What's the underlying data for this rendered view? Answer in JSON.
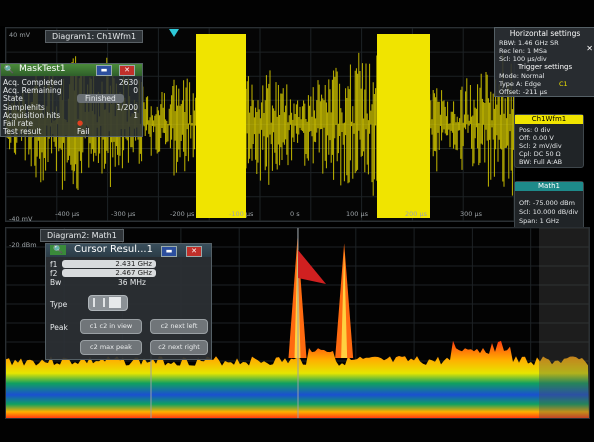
{
  "colors": {
    "waveform": "#f0e400",
    "accent_cyan": "#2ec8d8",
    "panel": "#2c3135",
    "spectrum_hot": "#ff3b10",
    "spectrum_warm": "#ffb000",
    "spectrum_cool": "#10a060"
  },
  "diagram1": {
    "tab": "Diagram1: Ch1Wfm1",
    "y_labels": [
      "40 mV",
      "",
      "",
      "",
      "",
      "",
      "",
      "",
      "-40 mV"
    ],
    "x_labels": [
      "-400 µs",
      "-300 µs",
      "-200 µs",
      "-100 µs",
      "0 s",
      "100 µs",
      "200 µs",
      "300 µs"
    ]
  },
  "diagram2": {
    "tab": "Diagram2: Math1",
    "y_labels": [
      "-20 dBm",
      "",
      "",
      "",
      "",
      "",
      "",
      "",
      "",
      "",
      ""
    ]
  },
  "mask_dialog": {
    "title": "MaskTest1",
    "rows": [
      {
        "label": "Acq. Completed",
        "value": "2630"
      },
      {
        "label": "Acq. Remaining",
        "value": "0"
      },
      {
        "label": "State",
        "value": "Finished"
      },
      {
        "label": "Samplehits",
        "value": "1/200"
      },
      {
        "label": "Acquisition hits",
        "value": "1"
      },
      {
        "label": "Fail rate",
        "value": ""
      },
      {
        "label": "Test result",
        "value": "Fail"
      }
    ]
  },
  "horizontal": {
    "title": "Horizontal settings",
    "rows": [
      "RBW: 1.46 GHz SR",
      "Rec len: 1 MSa",
      "Scl: 100 µs/div"
    ],
    "trigger_title": "Trigger settings",
    "trigger_rows": [
      "Mode: Normal",
      "Type A: Edge",
      "Offset: -211 µs"
    ],
    "trigger_ch": "C1"
  },
  "ch1_box": {
    "title": "Ch1Wfm1",
    "rows": [
      "Pos: 0 div",
      "Off: 0.00 V",
      "Scl: 2 mV/div",
      "Cpl: DC 50 Ω",
      "BW: Full A:AB"
    ]
  },
  "math_box": {
    "title": "Math1",
    "rows": [
      "Off: -75.000 dBm",
      "Scl: 10.000 dB/div",
      "Span: 1 GHz"
    ]
  },
  "cursor_dialog": {
    "title": "Cursor Resul...1",
    "f1_label": "f1",
    "f1_value": "2.431 GHz",
    "f2_label": "f2",
    "f2_value": "2.467 GHz",
    "bw_label": "Bw",
    "bw_value": "36 MHz",
    "type_label": "Type",
    "peak_label": "Peak",
    "buttons": [
      "c1 c2 in view",
      "c2 next left",
      "c2 max peak",
      "c2 next right"
    ]
  },
  "spectrum": {
    "peaks": [
      {
        "x_fraction": 0.5,
        "height_fraction": 0.95
      },
      {
        "x_fraction": 0.58,
        "height_fraction": 0.92
      }
    ]
  }
}
